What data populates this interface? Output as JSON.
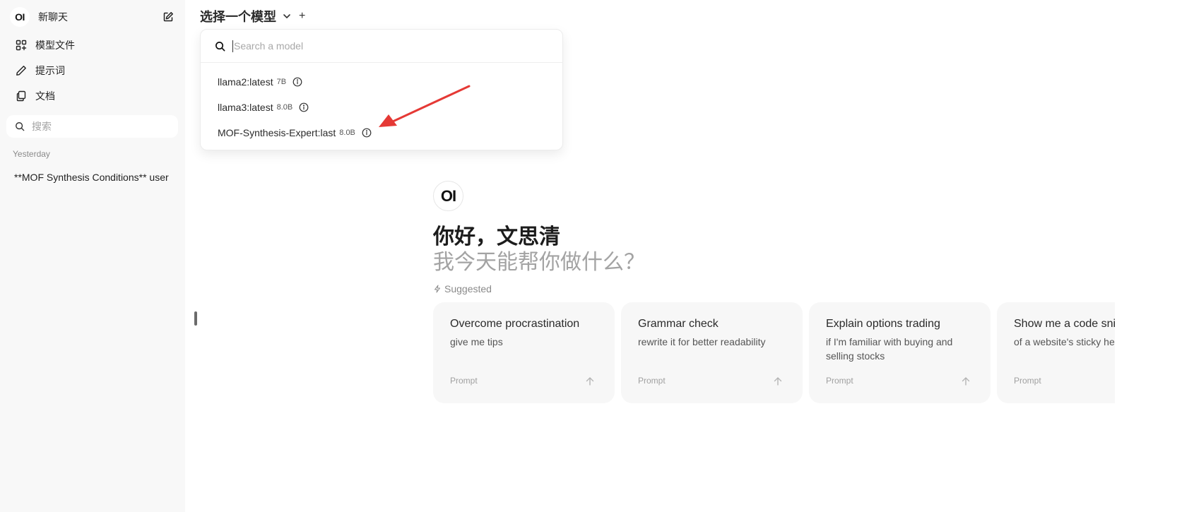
{
  "sidebar": {
    "logo": "OI",
    "new_chat": "新聊天",
    "items": [
      {
        "label": "模型文件",
        "icon": "grid-plus-icon"
      },
      {
        "label": "提示词",
        "icon": "pencil-icon"
      },
      {
        "label": "文档",
        "icon": "documents-icon"
      }
    ],
    "search_placeholder": "搜索",
    "section_label": "Yesterday",
    "chats": [
      "**MOF Synthesis Conditions** user"
    ]
  },
  "header": {
    "model_selector_label": "选择一个模型",
    "add_label": "+"
  },
  "dropdown": {
    "search_placeholder": "Search a model",
    "models": [
      {
        "name": "llama2:latest",
        "size": "7B"
      },
      {
        "name": "llama3:latest",
        "size": "8.0B"
      },
      {
        "name": "MOF-Synthesis-Expert:last",
        "size": "8.0B"
      }
    ]
  },
  "main": {
    "logo": "OI",
    "greeting": "你好，文思清",
    "subtitle": "我今天能帮你做什么？",
    "suggested_label": "Suggested",
    "suggestions": [
      {
        "title": "Overcome procrastination",
        "subtitle": "give me tips",
        "tag": "Prompt"
      },
      {
        "title": "Grammar check",
        "subtitle": "rewrite it for better readability",
        "tag": "Prompt"
      },
      {
        "title": "Explain options trading",
        "subtitle": "if I'm familiar with buying and selling stocks",
        "tag": "Prompt"
      },
      {
        "title": "Show me a code snippet",
        "subtitle": "of a website's sticky header",
        "tag": "Prompt"
      }
    ]
  },
  "colors": {
    "sidebar_bg": "#f8f8f8",
    "card_bg": "#f7f7f7",
    "annotation_arrow": "#e53935"
  }
}
